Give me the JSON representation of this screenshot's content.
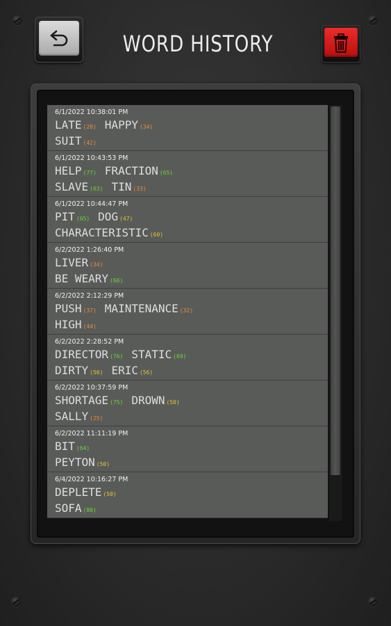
{
  "header": {
    "title": "WORD HISTORY",
    "back_icon": "undo-arrow-icon",
    "trash_icon": "trash-icon"
  },
  "colors": {
    "accent_red": "#d61c1c",
    "score_orange": "#ec8d34",
    "score_green": "#6ed82f",
    "score_yellow": "#e8c62a"
  },
  "entries": [
    {
      "date": "6/1/2022 10:38:01 PM",
      "lines": [
        [
          {
            "w": "LATE",
            "s": "(28)",
            "c": "orange"
          },
          {
            "w": "HAPPY",
            "s": "(34)",
            "c": "orange"
          }
        ],
        [
          {
            "w": "SUIT",
            "s": "(42)",
            "c": "orange"
          }
        ]
      ]
    },
    {
      "date": "6/1/2022 10:43:53 PM",
      "lines": [
        [
          {
            "w": "HELP",
            "s": "(77)",
            "c": "green"
          },
          {
            "w": "FRACTION",
            "s": "(65)",
            "c": "green"
          }
        ],
        [
          {
            "w": "SLAVE",
            "s": "(63)",
            "c": "green"
          },
          {
            "w": "TIN",
            "s": "(33)",
            "c": "orange"
          }
        ]
      ]
    },
    {
      "date": "6/1/2022 10:44:47 PM",
      "lines": [
        [
          {
            "w": "PIT",
            "s": "(65)",
            "c": "green"
          },
          {
            "w": "DOG",
            "s": "(47)",
            "c": "yellow"
          }
        ],
        [
          {
            "w": "CHARACTERISTIC",
            "s": "(60)",
            "c": "yellow"
          }
        ]
      ]
    },
    {
      "date": "6/2/2022 1:26:40 PM",
      "lines": [
        [
          {
            "w": "LIVER",
            "s": "(34)",
            "c": "orange"
          }
        ],
        [
          {
            "w": "BE WEARY",
            "s": "(66)",
            "c": "green"
          }
        ]
      ]
    },
    {
      "date": "6/2/2022 2:12:29 PM",
      "lines": [
        [
          {
            "w": "PUSH",
            "s": "(37)",
            "c": "orange"
          },
          {
            "w": "MAINTENANCE",
            "s": "(32)",
            "c": "orange"
          }
        ],
        [
          {
            "w": "HIGH",
            "s": "(44)",
            "c": "orange"
          }
        ]
      ]
    },
    {
      "date": "6/2/2022 2:28:52 PM",
      "lines": [
        [
          {
            "w": "DIRECTOR",
            "s": "(76)",
            "c": "green"
          },
          {
            "w": "STATIC",
            "s": "(69)",
            "c": "green"
          }
        ],
        [
          {
            "w": "DIRTY",
            "s": "(56)",
            "c": "yellow"
          },
          {
            "w": "ERIC",
            "s": "(56)",
            "c": "yellow"
          }
        ]
      ]
    },
    {
      "date": "6/2/2022 10:37:59 PM",
      "lines": [
        [
          {
            "w": "SHORTAGE",
            "s": "(75)",
            "c": "green"
          },
          {
            "w": "DROWN",
            "s": "(50)",
            "c": "yellow"
          }
        ],
        [
          {
            "w": "SALLY",
            "s": "(25)",
            "c": "orange"
          }
        ]
      ]
    },
    {
      "date": "6/2/2022 11:11:19 PM",
      "lines": [
        [
          {
            "w": "BIT",
            "s": "(64)",
            "c": "green"
          }
        ],
        [
          {
            "w": "PEYTON",
            "s": "(50)",
            "c": "yellow"
          }
        ]
      ]
    },
    {
      "date": "6/4/2022 10:16:27 PM",
      "lines": [
        [
          {
            "w": "DEPLETE",
            "s": "(50)",
            "c": "yellow"
          }
        ],
        [
          {
            "w": "SOFA",
            "s": "(80)",
            "c": "green"
          }
        ]
      ]
    }
  ]
}
